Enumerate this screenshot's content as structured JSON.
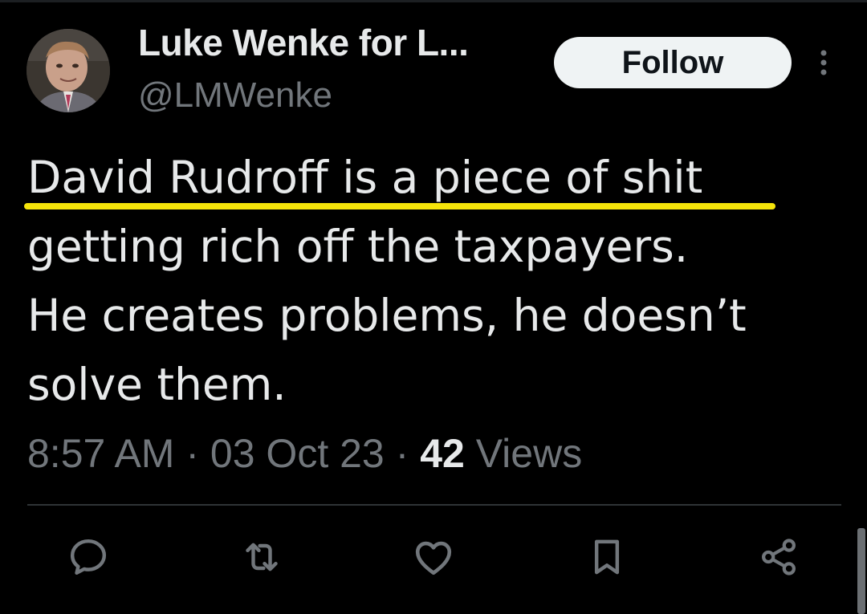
{
  "author": {
    "display_name": "Luke Wenke for L...",
    "handle": "@LMWenke"
  },
  "follow_label": "Follow",
  "tweet": {
    "lines": [
      "David Rudroff is a piece of shit",
      "getting rich off the taxpayers.",
      "He creates problems, he doesn’t",
      "solve them."
    ],
    "highlight_color": "#f5e40a"
  },
  "meta": {
    "time": "8:57 AM",
    "separator": "·",
    "date": "03 Oct 23",
    "views_count": "42",
    "views_label": "Views"
  },
  "actions": [
    {
      "icon": "reply-icon"
    },
    {
      "icon": "retweet-icon"
    },
    {
      "icon": "like-icon"
    },
    {
      "icon": "bookmark-icon"
    },
    {
      "icon": "share-icon"
    }
  ],
  "colors": {
    "background": "#000000",
    "text": "#e7e9ea",
    "secondary_text": "#71767b",
    "divider": "#2f3336",
    "follow_bg": "#eff3f4",
    "follow_text": "#0f1419"
  }
}
